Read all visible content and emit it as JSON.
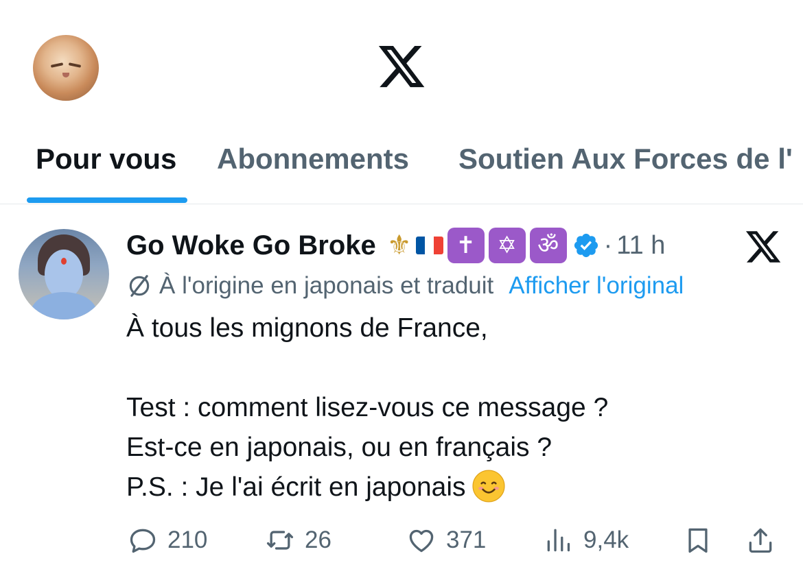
{
  "header": {
    "logo_icon": "x-logo-icon",
    "my_avatar": "my-profile-avatar"
  },
  "tabs": [
    {
      "label": "Pour vous",
      "active": true
    },
    {
      "label": "Abonnements",
      "active": false
    },
    {
      "label": "Soutien Aux Forces de l'",
      "active": false
    }
  ],
  "tweet": {
    "author": {
      "display_name": "Go Woke Go Broke",
      "badges": [
        "fleur-de-lis-icon",
        "french-flag-icon",
        "latin-cross-icon",
        "star-of-david-icon",
        "om-icon"
      ],
      "badge_glyphs": {
        "fleur": "⚜",
        "cross": "✝",
        "star": "✡",
        "om": "ॐ"
      },
      "verified": true
    },
    "separator": "·",
    "time": "11 h",
    "translation_note": "À l'origine en japonais et traduit",
    "show_original_label": "Afficher l'original",
    "text_lines": [
      "À tous les mignons de France,",
      "",
      "Test : comment lisez-vous ce message ?",
      "Est-ce en japonais, ou en français ?",
      "P.S. : Je l'ai écrit en japonais"
    ],
    "stats": {
      "replies": "210",
      "reposts": "26",
      "likes": "371",
      "views": "9,4k"
    }
  },
  "colors": {
    "accent": "#1d9bf0",
    "text_primary": "#0f1419",
    "text_secondary": "#536471",
    "badge_purple": "#9b59c9",
    "fleur_gold": "#c99a2e",
    "flag_blue": "#0055a4",
    "flag_red": "#ef4135"
  }
}
